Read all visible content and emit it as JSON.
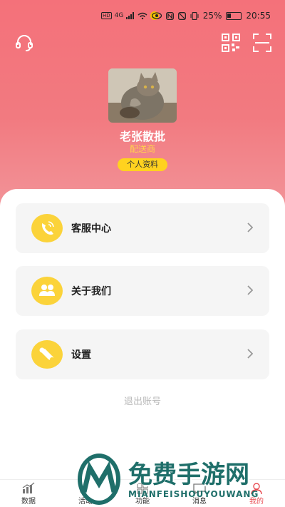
{
  "status_bar": {
    "left_badges": [
      "HD",
      "4G"
    ],
    "battery": "25%",
    "time": "20:55"
  },
  "header": {
    "icons": {
      "left": "headset-icon",
      "qr": "qr-code-icon",
      "scan": "scan-icon"
    }
  },
  "profile": {
    "name": "老张散批",
    "role": "配送商",
    "button": "个人资料"
  },
  "menu": [
    {
      "label": "客服中心",
      "icon": "phone-icon"
    },
    {
      "label": "关于我们",
      "icon": "people-icon"
    },
    {
      "label": "设置",
      "icon": "wrench-icon"
    }
  ],
  "logout": "退出账号",
  "tabs": [
    {
      "label": "数据",
      "icon": "chart-icon"
    },
    {
      "label": "活动",
      "icon": "activity-icon"
    },
    {
      "label": "功能",
      "icon": "grid-icon"
    },
    {
      "label": "消息",
      "icon": "message-icon"
    },
    {
      "label": "我的",
      "icon": "user-icon",
      "active": true
    }
  ],
  "watermark": {
    "title": "免费手游网",
    "sub": "MIANFEISHOUYOUWANG"
  },
  "colors": {
    "header": "#f4717a",
    "accent": "#fbd33a",
    "active_tab": "#e8484f",
    "watermark": "#1f6f6a"
  }
}
